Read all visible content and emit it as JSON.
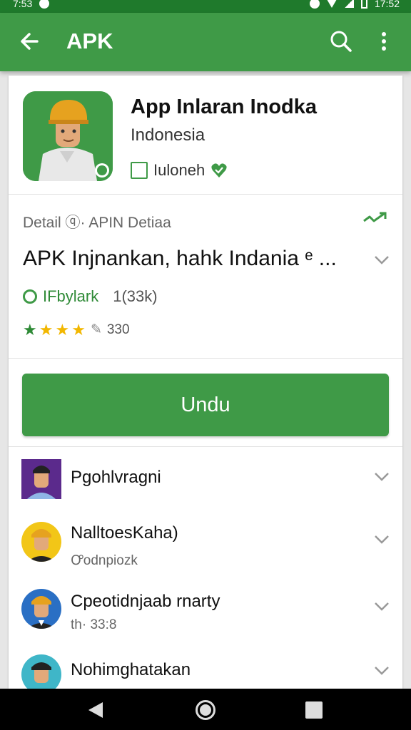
{
  "status_bar": {
    "time_left": "7:53",
    "time_right": "17:52"
  },
  "app_bar": {
    "title": "APK"
  },
  "app": {
    "name": "App Inlaran Inodka",
    "subtitle": "Indonesia",
    "verify_label": "Iuloneh"
  },
  "detail": {
    "label": "Detail ⓠ· APIN Detiaa",
    "title": "APK  Injnankan, hahk Indania ᵉ ...",
    "developer": "IFbylark",
    "count": "1(33k)",
    "rating_text": "330",
    "stars": 4
  },
  "download": {
    "label": "Undu"
  },
  "list": [
    {
      "name": "Pgohlvragni",
      "sub": ""
    },
    {
      "name": "NalltoesKaha)",
      "sub": "Ꝍodnpiozk"
    },
    {
      "name": "Cpeotidnjaab rnarty",
      "sub": "th· 33:8"
    },
    {
      "name": "Nohimghatakan",
      "sub": ""
    }
  ],
  "colors": {
    "primary": "#3f9a47",
    "status_bar": "#1f7a2c",
    "star": "#f2b701"
  }
}
